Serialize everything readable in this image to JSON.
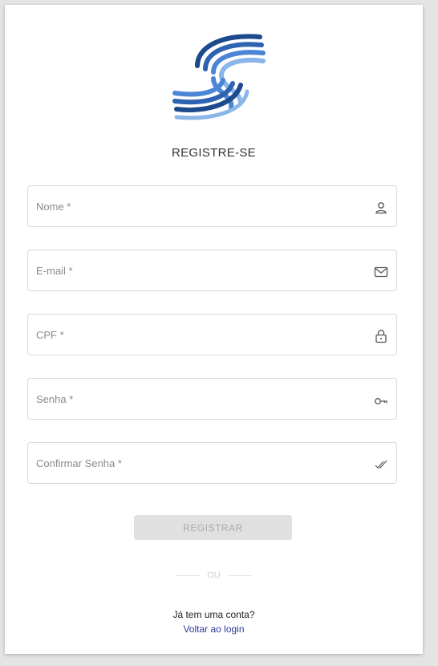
{
  "header": {
    "title": "REGISTRE-SE"
  },
  "form": {
    "fields": [
      {
        "label": "Nome *",
        "icon": "user-icon"
      },
      {
        "label": "E-mail *",
        "icon": "mail-icon"
      },
      {
        "label": "CPF *",
        "icon": "lock-icon"
      },
      {
        "label": "Senha *",
        "icon": "key-icon"
      },
      {
        "label": "Confirmar Senha *",
        "icon": "double-check-icon"
      }
    ],
    "submit_label": "REGISTRAR"
  },
  "divider": {
    "text": "OU"
  },
  "footer": {
    "question": "Já tem uma conta?",
    "login_link": "Voltar ao login"
  },
  "colors": {
    "brand_dark": "#1d4a8c",
    "brand_mid": "#3f7dd1",
    "brand_light": "#8ab6ea",
    "link": "#2a3a9c"
  }
}
